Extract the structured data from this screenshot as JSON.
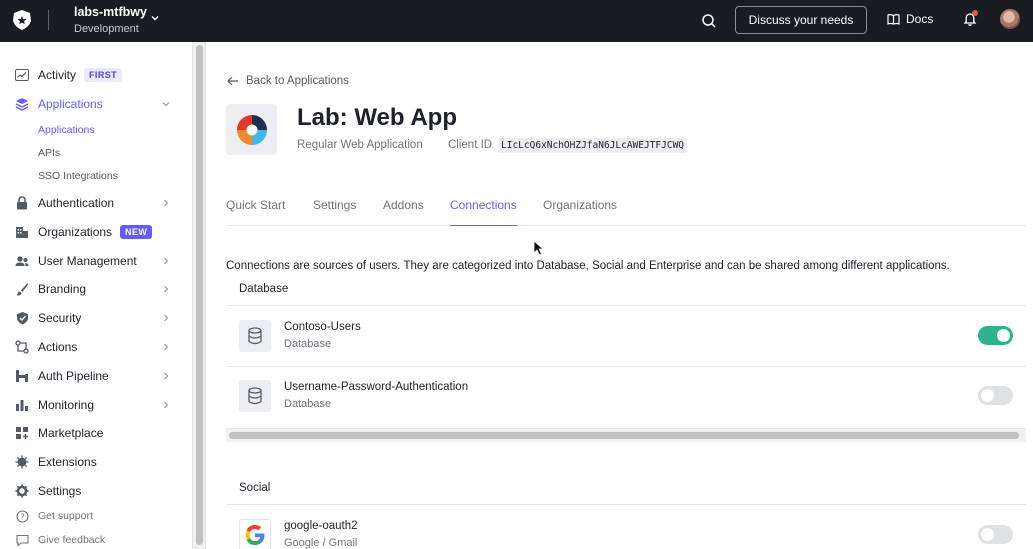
{
  "topbar": {
    "tenant_name": "labs-mtfbwy",
    "tenant_env": "Development",
    "discuss_label": "Discuss your needs",
    "docs_label": "Docs",
    "icons": [
      "auth0-logo-icon",
      "chevron-down-icon",
      "search-icon",
      "book-icon",
      "bell-icon",
      "avatar"
    ]
  },
  "sidebar": {
    "items": [
      {
        "label": "Activity",
        "badge": "FIRST",
        "icon": "activity-icon"
      },
      {
        "label": "Applications",
        "icon": "layers-icon",
        "active": true
      },
      {
        "label": "Authentication",
        "icon": "lock-icon"
      },
      {
        "label": "Organizations",
        "badge": "NEW",
        "icon": "building-icon"
      },
      {
        "label": "User Management",
        "icon": "users-icon"
      },
      {
        "label": "Branding",
        "icon": "brush-icon"
      },
      {
        "label": "Security",
        "icon": "shield-icon"
      },
      {
        "label": "Actions",
        "icon": "actions-icon"
      },
      {
        "label": "Auth Pipeline",
        "icon": "pipeline-icon"
      },
      {
        "label": "Monitoring",
        "icon": "bar-chart-icon"
      },
      {
        "label": "Marketplace",
        "icon": "grid-plus-icon"
      },
      {
        "label": "Extensions",
        "icon": "puzzle-icon"
      },
      {
        "label": "Settings",
        "icon": "gear-icon"
      }
    ],
    "subitems": [
      "Applications",
      "APIs",
      "SSO Integrations"
    ],
    "footer": [
      "Get support",
      "Give feedback"
    ]
  },
  "main": {
    "back_label": "Back to Applications",
    "app_title": "Lab: Web App",
    "app_type": "Regular Web Application",
    "client_id_label": "Client ID",
    "client_id": "LIcLcQ6xNchOHZJfaN6JLcAWEJTFJCWQ",
    "tabs": [
      "Quick Start",
      "Settings",
      "Addons",
      "Connections",
      "Organizations"
    ],
    "active_tab": "Connections",
    "description": "Connections are sources of users. They are categorized into Database, Social and Enterprise and can be shared among different applications.",
    "sections": {
      "database_title": "Database",
      "social_title": "Social"
    },
    "connections": [
      {
        "name": "Contoso-Users",
        "type": "Database",
        "enabled": true
      },
      {
        "name": "Username-Password-Authentication",
        "type": "Database",
        "enabled": false
      },
      {
        "name": "google-oauth2",
        "type": "Google / Gmail",
        "enabled": false
      }
    ]
  },
  "colors": {
    "accent": "#635dff",
    "topbar": "#191c21",
    "toggle_on": "#2eb38f"
  }
}
